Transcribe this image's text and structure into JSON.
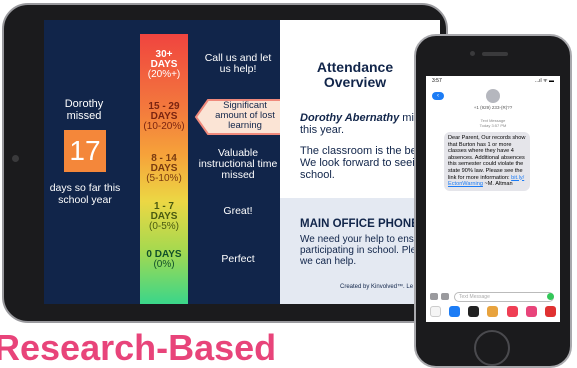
{
  "tablet": {
    "left": {
      "missed_label": "Dorothy missed",
      "days_count": "17",
      "days_so_far": "days so far this school year"
    },
    "scale": [
      {
        "days": "30+",
        "days_unit": "DAYS",
        "pct": "(20%+)",
        "label": "Call us and let us help!"
      },
      {
        "days": "15 - 29",
        "days_unit": "DAYS",
        "pct": "(10-20%)",
        "label": "Significant amount of lost learning"
      },
      {
        "days": "8 - 14",
        "days_unit": "DAYS",
        "pct": "(5-10%)",
        "label": "Valuable instructional time missed"
      },
      {
        "days": "1 - 7",
        "days_unit": "DAYS",
        "pct": "(0-5%)",
        "label": "Great!"
      },
      {
        "days": "0 DAYS",
        "days_unit": "",
        "pct": "(0%)",
        "label": "Perfect"
      }
    ],
    "right": {
      "title": "Attendance Overview",
      "student_name": "Dorothy Abernathy",
      "line1_rest": " miss",
      "line2": "this year.",
      "para2_l1": "The classroom is the bes",
      "para2_l2": "We look forward to seein",
      "para2_l3": "school.",
      "phone_title": "MAIN OFFICE PHONE:",
      "phone_l1": "We need your help to ensu",
      "phone_l2": "participating in school. Plea",
      "phone_l3": "we can help.",
      "created_by": "Created by Kinvolved™. Le"
    }
  },
  "phone": {
    "time": "3:57",
    "signal": "...ıl ᯤ ▬",
    "back_label": "Back",
    "number": "+1 (929) 233-(R)??",
    "msg_type": "Text Message",
    "msg_time": "Today 3:57 PM",
    "message": "Dear Parent, Our records show that Burton has 1 or more classes where they have 4 absences. Additional absences this semester could violate the state 90% law. Please see the link for more information:",
    "link": "bit.ly/ EctonWarning",
    "sign": "~M. Altman",
    "input_placeholder": "Text Message"
  },
  "heading": "Research-Based"
}
